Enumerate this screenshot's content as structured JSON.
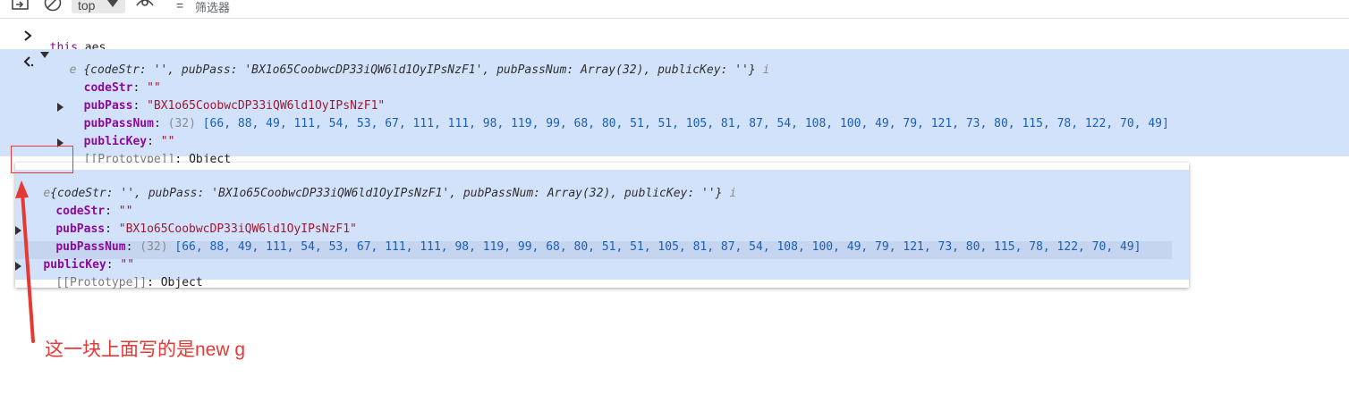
{
  "toolbar": {
    "context": "top",
    "filter_placeholder": "筛选器"
  },
  "input": {
    "text": "this.aes"
  },
  "result": {
    "summary_prefix": "e",
    "summary": "{codeStr: '', pubPass: 'BX1o65CoobwcDP33iQW6ld1OyIPsNzF1', pubPassNum: Array(32), publicKey: ''}",
    "info": "i",
    "props": {
      "codeStr": {
        "key": "codeStr",
        "value": "\"\""
      },
      "pubPass": {
        "key": "pubPass",
        "value": "\"BX1o65CoobwcDP33iQW6ld1OyIPsNzF1\""
      },
      "pubPassNum": {
        "key": "pubPassNum",
        "len": "(32)",
        "value": "[66, 88, 49, 111, 54, 53, 67, 111, 111, 98, 119, 99, 68, 80, 51, 51, 105, 81, 87, 54, 108, 100, 49, 79, 121, 73, 80, 115, 78, 122, 70, 49]"
      },
      "publicKey": {
        "key": "publicKey",
        "value": "\"\""
      },
      "prototype": {
        "key": "[[Prototype]]",
        "value": "Object"
      }
    }
  },
  "pasted": {
    "summary_prefix": "e",
    "summary": "{codeStr: '', pubPass: 'BX1o65CoobwcDP33iQW6ld1OyIPsNzF1', pubPassNum: Array(32), publicKey: ''}",
    "info": "i"
  },
  "annotation": {
    "text": "这一块上面写的是new g"
  },
  "colors": {
    "accent_red": "#e53935",
    "selection_bg": "#d3e2fb"
  }
}
